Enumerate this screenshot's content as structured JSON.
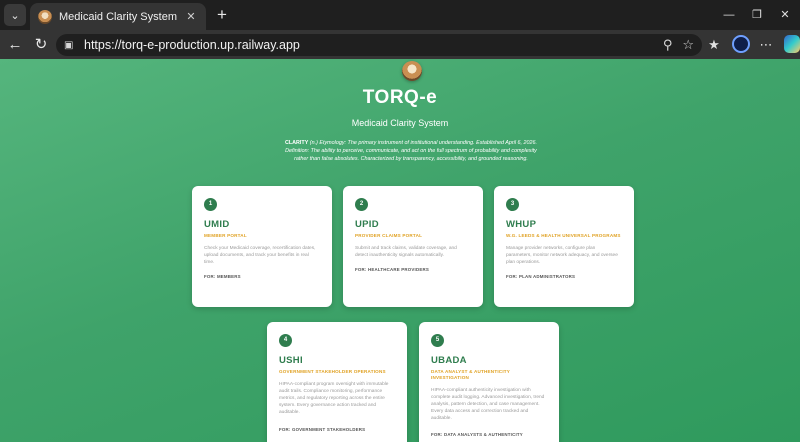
{
  "browser": {
    "tab_title": "Medicaid Clarity System",
    "url": "https://torq-e-production.up.railway.app"
  },
  "page": {
    "brand": "TORQ-e",
    "subtitle": "Medicaid Clarity System",
    "definition_term": "CLARITY",
    "definition_text": " (n.) Etymology: The primary instrument of institutional understanding. Established April 6, 2026. Definition: The ability to perceive, communicate, and act on the full spectrum of probability and complexity rather than false absolutes. Characterized by transparency, accessibility, and grounded reasoning.",
    "cards": [
      {
        "number": "1",
        "title": "UMID",
        "subtitle": "MEMBER PORTAL",
        "description": "Check your Medicaid coverage, recertification dates, upload documents, and track your benefits in real time.",
        "audience": "FOR: MEMBERS"
      },
      {
        "number": "2",
        "title": "UPID",
        "subtitle": "PROVIDER CLAIMS PORTAL",
        "description": "Submit and track claims, validate coverage, and detect inauthenticity signals automatically.",
        "audience": "FOR: HEALTHCARE PROVIDERS"
      },
      {
        "number": "3",
        "title": "WHUP",
        "subtitle": "W.G. LEEDS & HEALTH UNIVERSAL PROGRAMS",
        "description": "Manage provider networks, configure plan parameters, monitor network adequacy, and oversee plan operations.",
        "audience": "FOR: PLAN ADMINISTRATORS"
      },
      {
        "number": "4",
        "title": "USHI",
        "subtitle": "GOVERNMENT STAKEHOLDER OPERATIONS",
        "description": "HIPAA-compliant program oversight with immutable audit trails. Compliance monitoring, performance metrics, and regulatory reporting across the entire system. Every governance action tracked and auditable.",
        "audience": "FOR: GOVERNMENT STAKEHOLDERS"
      },
      {
        "number": "5",
        "title": "UBADA",
        "subtitle": "DATA ANALYST & AUTHENTICITY INVESTIGATION",
        "description": "HIPAA-compliant authenticity investigation with complete audit logging. Advanced investigation, trend analysis, pattern detection, and case management. Every data access and correction tracked and auditable.",
        "audience": "FOR: DATA ANALYSTS & AUTHENTICITY"
      }
    ]
  }
}
